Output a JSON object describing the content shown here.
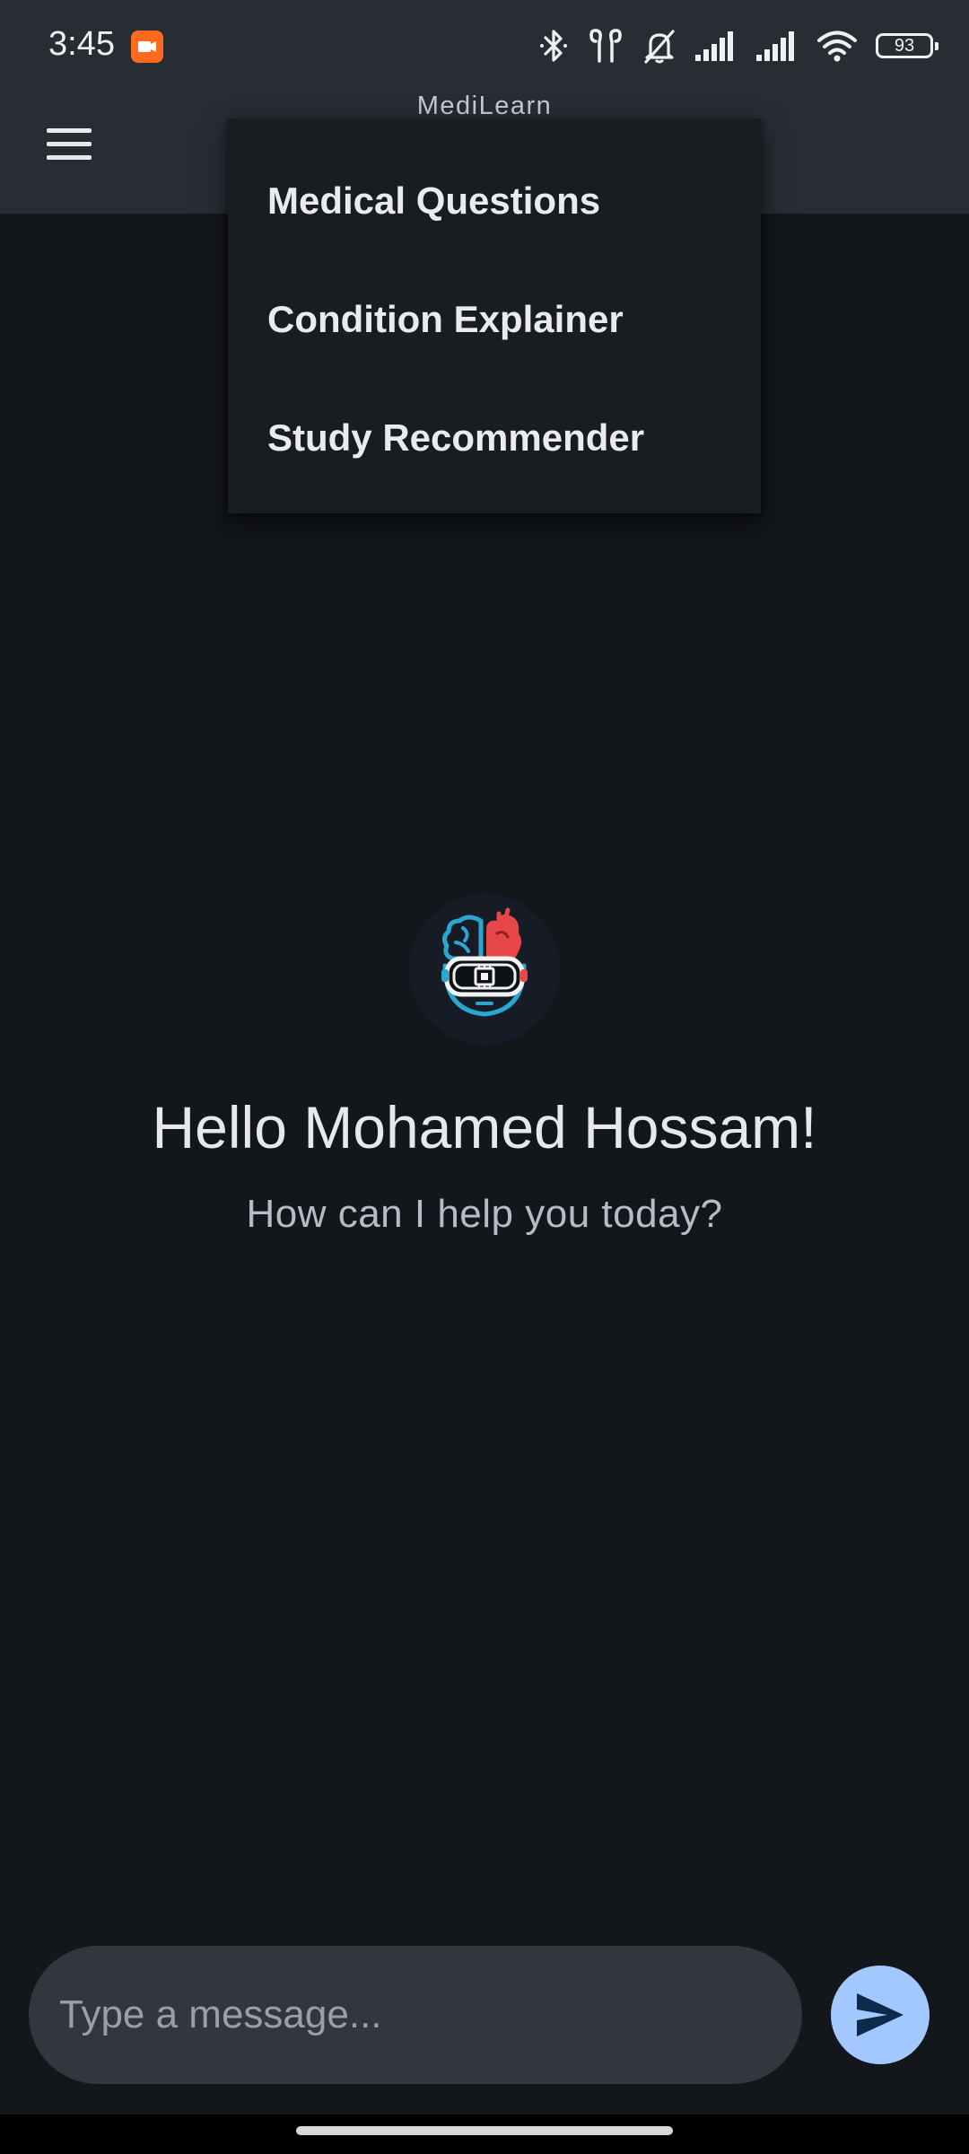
{
  "status_bar": {
    "time": "3:45",
    "battery_level": "93",
    "icons": [
      "screen-record-icon",
      "bluetooth-icon",
      "earbuds-icon",
      "bell-off-icon",
      "signal-icon",
      "signal-icon",
      "wifi-icon",
      "battery-icon"
    ]
  },
  "app_bar": {
    "title": "MediLearn",
    "menu_icon": "hamburger-menu-icon"
  },
  "dropdown": {
    "items": [
      {
        "label": "Medical Questions"
      },
      {
        "label": "Condition Explainer"
      },
      {
        "label": "Study Recommender"
      }
    ]
  },
  "welcome": {
    "avatar_icon": "brain-heart-vr-logo-icon",
    "greeting": "Hello Mohamed Hossam!",
    "subtitle": "How can I help you today?"
  },
  "composer": {
    "placeholder": "Type a message...",
    "value": "",
    "send_icon": "send-icon"
  },
  "colors": {
    "background": "#13161b",
    "app_bar": "#282c33",
    "menu": "#191c21",
    "input": "#33363c",
    "send_button": "#a3c8ff",
    "send_icon": "#0e2a4a",
    "brain": "#2aa7cf",
    "heart": "#e8474a"
  }
}
